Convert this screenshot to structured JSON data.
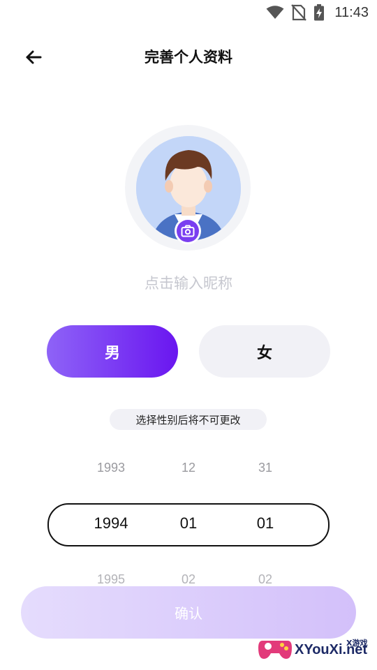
{
  "status_bar": {
    "time": "11:43",
    "icons": [
      "wifi-icon",
      "no-sim-icon",
      "battery-charging-icon"
    ]
  },
  "header": {
    "title": "完善个人资料",
    "back_icon": "arrow-left-icon"
  },
  "avatar": {
    "camera_icon": "camera-icon"
  },
  "nickname": {
    "placeholder": "点击输入昵称"
  },
  "gender": {
    "male_label": "男",
    "female_label": "女",
    "selected": "male",
    "note": "选择性别后将不可更改"
  },
  "date_picker": {
    "prev": {
      "year": "1993",
      "month": "12",
      "day": "31"
    },
    "selected": {
      "year": "1994",
      "month": "01",
      "day": "01"
    },
    "next": {
      "year": "1995",
      "month": "02",
      "day": "02"
    }
  },
  "confirm_label": "确认",
  "watermark": {
    "text": "XYouXi.net",
    "small": "X游戏"
  },
  "colors": {
    "accent_start": "#8e63f7",
    "accent_end": "#6a16f0",
    "confirm_disabled": "#dccdfb"
  }
}
